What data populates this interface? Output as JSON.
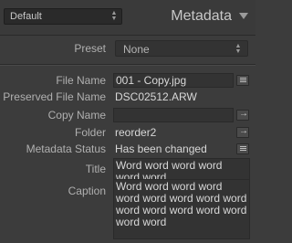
{
  "header": {
    "preset_dropdown_value": "Default",
    "panel_title": "Metadata"
  },
  "preset": {
    "label": "Preset",
    "value": "None"
  },
  "fields": {
    "file_name": {
      "label": "File Name",
      "value": "001 - Copy.jpg"
    },
    "preserved_file_name": {
      "label": "Preserved File Name",
      "value": "DSC02512.ARW"
    },
    "copy_name": {
      "label": "Copy Name",
      "value": ""
    },
    "folder": {
      "label": "Folder",
      "value": "reorder2"
    },
    "metadata_status": {
      "label": "Metadata Status",
      "value": "Has been changed"
    },
    "title": {
      "label": "Title",
      "value": "Word word word word word word"
    },
    "caption": {
      "label": "Caption",
      "value": "Word word word word word word word word word word word word word word word word"
    }
  },
  "icons": {
    "updown": "updown-arrows-icon",
    "collapse": "collapse-triangle-icon",
    "list": "list-icon",
    "arrow": "go-to-arrow-icon"
  }
}
